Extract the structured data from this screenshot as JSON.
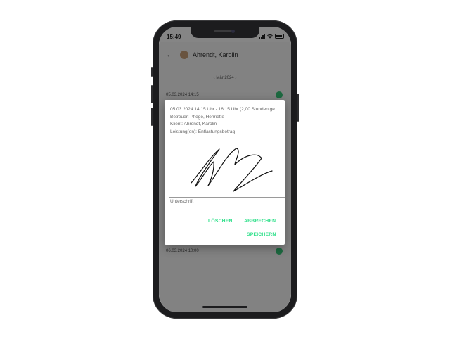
{
  "status_bar": {
    "time": "15:49",
    "icons": [
      "cellular-signal-icon",
      "wifi-icon",
      "battery-icon"
    ]
  },
  "background_app": {
    "title": "Ahrendt, Karolin",
    "date_nav": "‹   Mär 2024   ›",
    "list_rows": [
      "05.03.2024  14:15",
      "06.03.2024  10:00"
    ]
  },
  "dialog": {
    "info_lines": [
      "05.03.2024 14:15 Uhr - 16:15 Uhr (2,00 Stunden ge",
      "Betreuer: Pflege, Henriette",
      "Klient: Ahrendt, Karolin",
      "Leistung(en): Entlastungsbetrag"
    ],
    "signature_label": "Unterschrift",
    "actions": {
      "delete": "LÖSCHEN",
      "cancel": "ABBRECHEN",
      "save": "SPEICHERN"
    }
  },
  "colors": {
    "accent": "#2ee08a",
    "overlay": "rgba(0,0,0,0.48)",
    "phone_frame": "#1c1c1e"
  }
}
